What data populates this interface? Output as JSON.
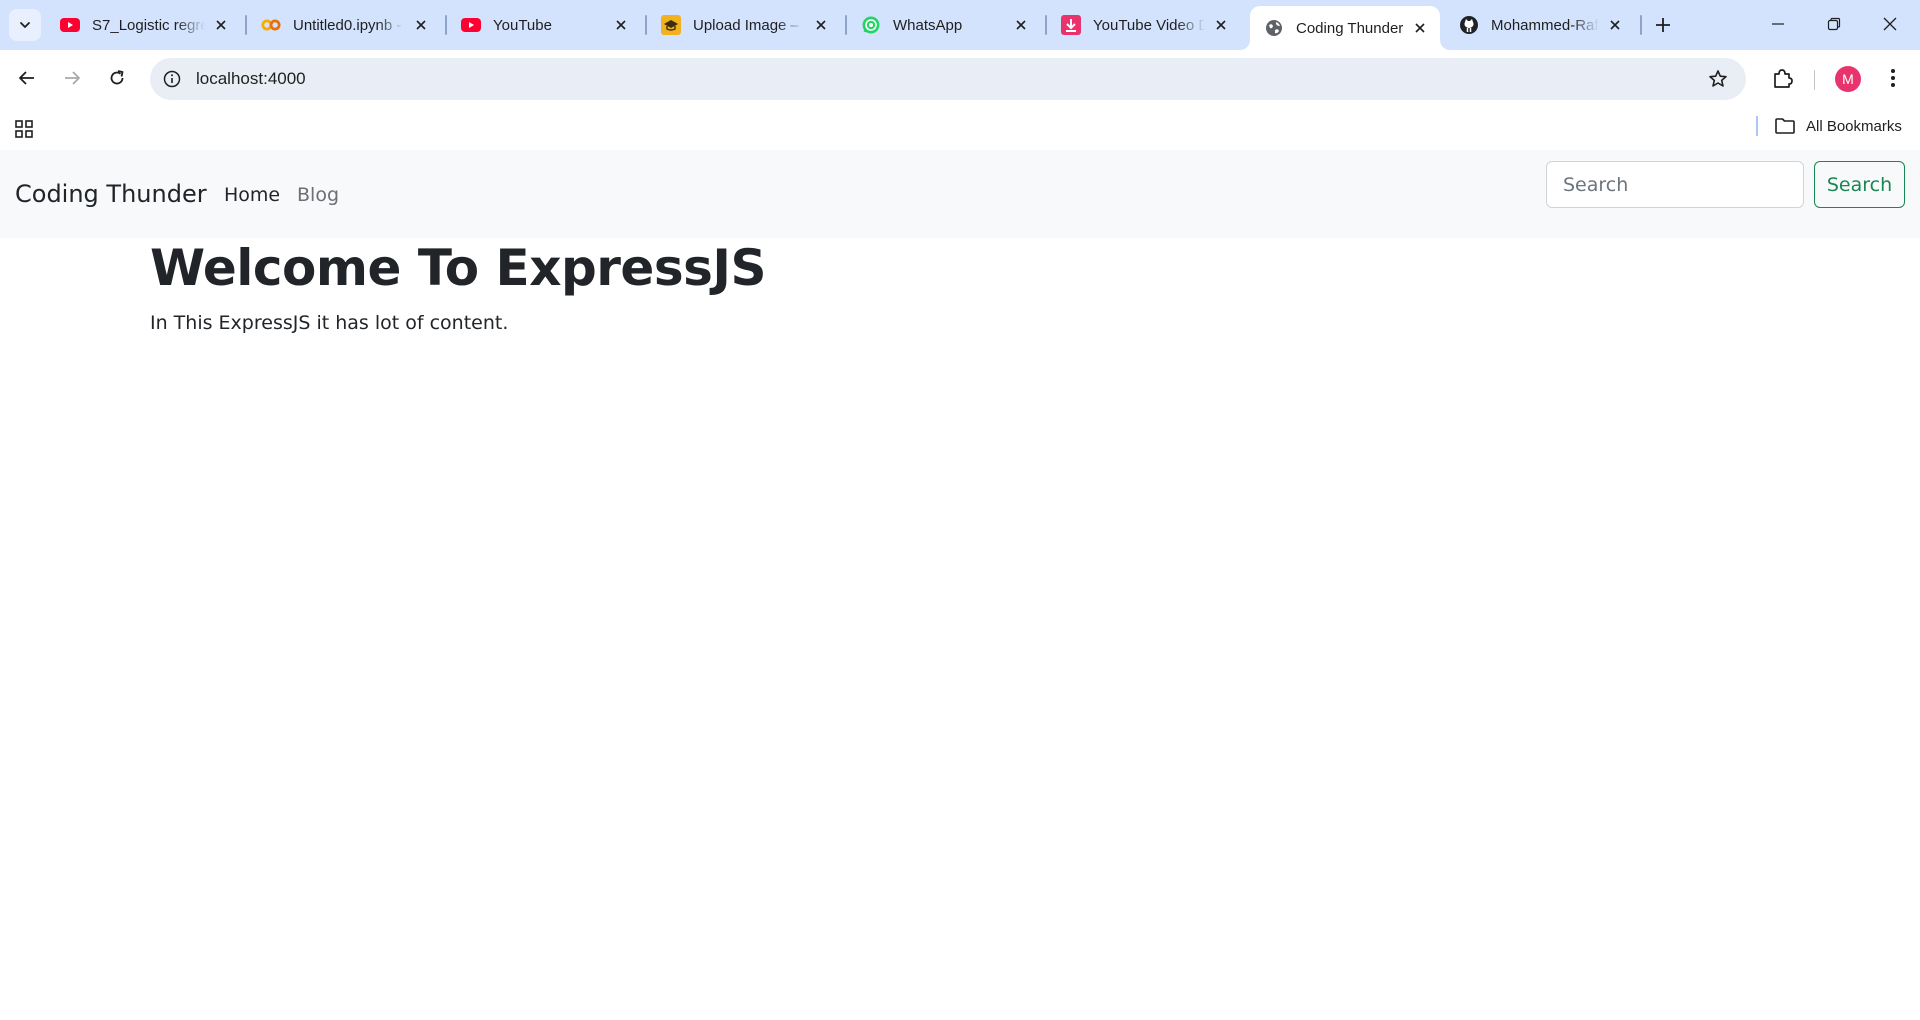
{
  "browser": {
    "tabs": [
      {
        "title": "S7_Logistic regre",
        "icon": "youtube-icon",
        "active": false
      },
      {
        "title": "Untitled0.ipynb -",
        "icon": "colab-icon",
        "active": false
      },
      {
        "title": "YouTube",
        "icon": "youtube-icon",
        "active": false
      },
      {
        "title": "Upload Image –",
        "icon": "upload-image-icon",
        "active": false
      },
      {
        "title": "WhatsApp",
        "icon": "whatsapp-icon",
        "active": false
      },
      {
        "title": "YouTube Video D",
        "icon": "download-icon",
        "active": false
      },
      {
        "title": "Coding Thunder",
        "icon": "globe-icon",
        "active": true
      },
      {
        "title": "Mohammed-Raf",
        "icon": "github-icon",
        "active": false
      }
    ],
    "url": "localhost:4000",
    "profile_initial": "M",
    "bookmarks_label": "All Bookmarks",
    "colors": {
      "tabstrip": "#d3e3fd",
      "omnibox": "#e9eef6",
      "avatar": "#e8336d"
    }
  },
  "site": {
    "brand": "Coding Thunder",
    "nav": {
      "home": "Home",
      "blog": "Blog"
    },
    "search": {
      "placeholder": "Search",
      "button": "Search"
    },
    "hero": {
      "title": "Welcome To ExpressJS",
      "text": "In This ExpressJS it has lot of content."
    },
    "colors": {
      "navbar": "#f8f9fa",
      "search_button": "#198754",
      "text": "#212529"
    }
  }
}
